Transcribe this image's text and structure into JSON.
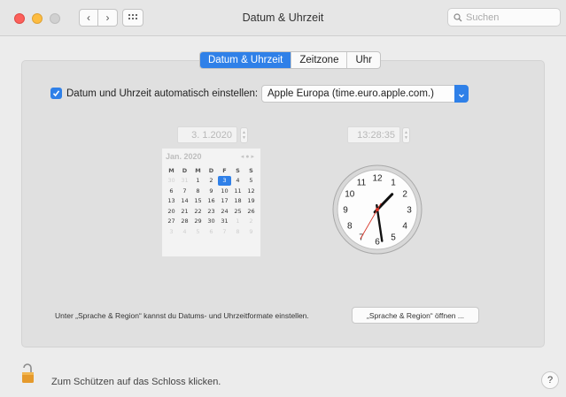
{
  "window": {
    "title": "Datum & Uhrzeit",
    "search_placeholder": "Suchen"
  },
  "tabs": [
    {
      "label": "Datum & Uhrzeit",
      "active": true
    },
    {
      "label": "Zeitzone",
      "active": false
    },
    {
      "label": "Uhr",
      "active": false
    }
  ],
  "auto": {
    "label": "Datum und Uhrzeit automatisch einstellen:",
    "checked": true,
    "server": "Apple Europa (time.euro.apple.com.)"
  },
  "date_field": "3.  1.2020",
  "time_field": "13:28:35",
  "calendar": {
    "month_label": "Jan. 2020",
    "weekdays": [
      "M",
      "D",
      "M",
      "D",
      "F",
      "S",
      "S"
    ],
    "rows": [
      [
        "30",
        "31",
        "1",
        "2",
        "3",
        "4",
        "5"
      ],
      [
        "6",
        "7",
        "8",
        "9",
        "10",
        "11",
        "12"
      ],
      [
        "13",
        "14",
        "15",
        "16",
        "17",
        "18",
        "19"
      ],
      [
        "20",
        "21",
        "22",
        "23",
        "24",
        "25",
        "26"
      ],
      [
        "27",
        "28",
        "29",
        "30",
        "31",
        "1",
        "2"
      ],
      [
        "3",
        "4",
        "5",
        "6",
        "7",
        "8",
        "9"
      ]
    ],
    "selected": "3"
  },
  "clock": {
    "numbers": [
      "12",
      "1",
      "2",
      "3",
      "4",
      "5",
      "6",
      "7",
      "8",
      "9",
      "10",
      "11"
    ],
    "time": {
      "hours": 13,
      "minutes": 28,
      "seconds": 35
    }
  },
  "footer": {
    "text": "Unter „Sprache & Region“ kannst du Datums- und Uhrzeitformate einstellen.",
    "button": "„Sprache & Region“ öffnen ..."
  },
  "lock_text": "Zum Schützen auf das Schloss klicken.",
  "help_label": "?",
  "colors": {
    "accent": "#2f80e8"
  }
}
